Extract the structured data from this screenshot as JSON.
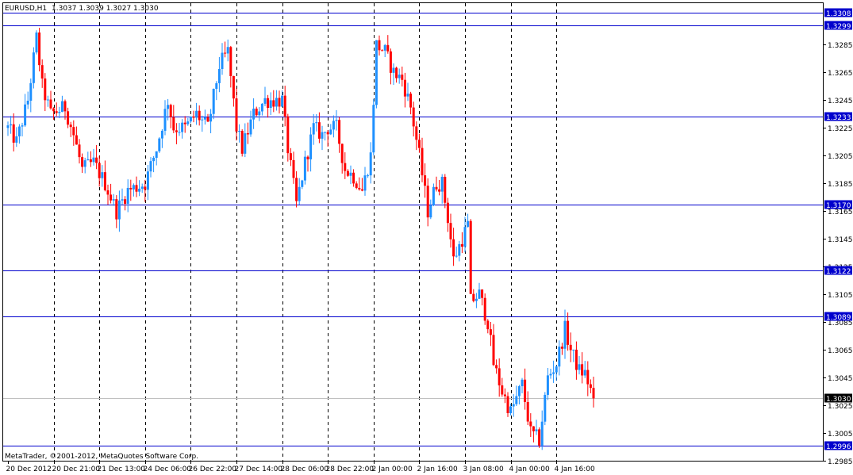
{
  "header": {
    "symbol_label": "EURUSD,H1",
    "ohlc_text": "1.3037 1.3039 1.3027 1.3030"
  },
  "footer": {
    "copyright": "MetaTrader, ©2001-2012, MetaQuotes Software Corp."
  },
  "colors": {
    "background": "#ffffff",
    "frame": "#000000",
    "grid": "#000000",
    "bull_candle": "#1e90ff",
    "bear_candle": "#ff0000",
    "level_line": "#0000cd",
    "level_label_bg": "#0000cd",
    "bid_line": "#c0c0c0",
    "bid_label_bg": "#000000"
  },
  "chart_data": {
    "type": "candlestick",
    "symbol": "EURUSD",
    "timeframe": "H1",
    "ylim": [
      1.2985,
      1.3315
    ],
    "grid": "vertical dashed",
    "y_ticks": [
      "1.3285",
      "1.3265",
      "1.3245",
      "1.3225",
      "1.3205",
      "1.3185",
      "1.3165",
      "1.3145",
      "1.3125",
      "1.3105",
      "1.3085",
      "1.3065",
      "1.3045",
      "1.3025",
      "1.3005",
      "1.2985"
    ],
    "y_tick_values": [
      1.3285,
      1.3265,
      1.3245,
      1.3225,
      1.3205,
      1.3185,
      1.3165,
      1.3145,
      1.3125,
      1.3105,
      1.3085,
      1.3065,
      1.3045,
      1.3025,
      1.3005,
      1.2985
    ],
    "x_ticks": [
      "20 Dec 2012",
      "20 Dec 21:00",
      "21 Dec 13:00",
      "24 Dec 06:00",
      "26 Dec 22:00",
      "27 Dec 14:00",
      "28 Dec 06:00",
      "28 Dec 22:00",
      "2 Jan 00:00",
      "2 Jan 16:00",
      "3 Jan 08:00",
      "4 Jan 00:00",
      "4 Jan 16:00"
    ],
    "bar_count": 224,
    "bars_per_x_tick": 16,
    "horizontal_levels": [
      "1.3308",
      "1.3299",
      "1.3233",
      "1.3170",
      "1.3122",
      "1.3089",
      "1.2996"
    ],
    "horizontal_level_values": [
      1.3308,
      1.3299,
      1.3233,
      1.317,
      1.3122,
      1.3089,
      1.2996
    ],
    "bid_label": "1.3030",
    "bid": 1.303,
    "close_path": [
      {
        "i": 0,
        "v": 1.3225
      },
      {
        "i": 3,
        "v": 1.3215
      },
      {
        "i": 7,
        "v": 1.3245
      },
      {
        "i": 10,
        "v": 1.329
      },
      {
        "i": 12,
        "v": 1.3255
      },
      {
        "i": 15,
        "v": 1.3235
      },
      {
        "i": 20,
        "v": 1.324
      },
      {
        "i": 23,
        "v": 1.322
      },
      {
        "i": 26,
        "v": 1.3195
      },
      {
        "i": 30,
        "v": 1.32
      },
      {
        "i": 34,
        "v": 1.3185
      },
      {
        "i": 38,
        "v": 1.3165
      },
      {
        "i": 42,
        "v": 1.318
      },
      {
        "i": 48,
        "v": 1.3185
      },
      {
        "i": 52,
        "v": 1.321
      },
      {
        "i": 56,
        "v": 1.3245
      },
      {
        "i": 58,
        "v": 1.3225
      },
      {
        "i": 62,
        "v": 1.3225
      },
      {
        "i": 66,
        "v": 1.3235
      },
      {
        "i": 70,
        "v": 1.3225
      },
      {
        "i": 74,
        "v": 1.327
      },
      {
        "i": 77,
        "v": 1.328
      },
      {
        "i": 80,
        "v": 1.3225
      },
      {
        "i": 82,
        "v": 1.321
      },
      {
        "i": 86,
        "v": 1.3235
      },
      {
        "i": 90,
        "v": 1.3245
      },
      {
        "i": 96,
        "v": 1.3245
      },
      {
        "i": 98,
        "v": 1.321
      },
      {
        "i": 101,
        "v": 1.317
      },
      {
        "i": 104,
        "v": 1.32
      },
      {
        "i": 107,
        "v": 1.3225
      },
      {
        "i": 110,
        "v": 1.322
      },
      {
        "i": 112,
        "v": 1.3225
      },
      {
        "i": 115,
        "v": 1.3225
      },
      {
        "i": 118,
        "v": 1.3195
      },
      {
        "i": 121,
        "v": 1.319
      },
      {
        "i": 124,
        "v": 1.318
      },
      {
        "i": 127,
        "v": 1.3205
      },
      {
        "i": 129,
        "v": 1.3285
      },
      {
        "i": 132,
        "v": 1.328
      },
      {
        "i": 135,
        "v": 1.3265
      },
      {
        "i": 138,
        "v": 1.326
      },
      {
        "i": 141,
        "v": 1.324
      },
      {
        "i": 144,
        "v": 1.3205
      },
      {
        "i": 147,
        "v": 1.3165
      },
      {
        "i": 150,
        "v": 1.3185
      },
      {
        "i": 152,
        "v": 1.3185
      },
      {
        "i": 154,
        "v": 1.316
      },
      {
        "i": 156,
        "v": 1.313
      },
      {
        "i": 159,
        "v": 1.3145
      },
      {
        "i": 161,
        "v": 1.3155
      },
      {
        "i": 162,
        "v": 1.31
      },
      {
        "i": 165,
        "v": 1.3105
      },
      {
        "i": 168,
        "v": 1.3085
      },
      {
        "i": 170,
        "v": 1.3055
      },
      {
        "i": 173,
        "v": 1.3035
      },
      {
        "i": 176,
        "v": 1.302
      },
      {
        "i": 180,
        "v": 1.304
      },
      {
        "i": 183,
        "v": 1.3005
      },
      {
        "i": 186,
        "v": 1.3
      },
      {
        "i": 189,
        "v": 1.3045
      },
      {
        "i": 192,
        "v": 1.3055
      },
      {
        "i": 195,
        "v": 1.308
      },
      {
        "i": 197,
        "v": 1.3065
      },
      {
        "i": 200,
        "v": 1.305
      },
      {
        "i": 202,
        "v": 1.3048
      },
      {
        "i": 205,
        "v": 1.303
      }
    ]
  }
}
